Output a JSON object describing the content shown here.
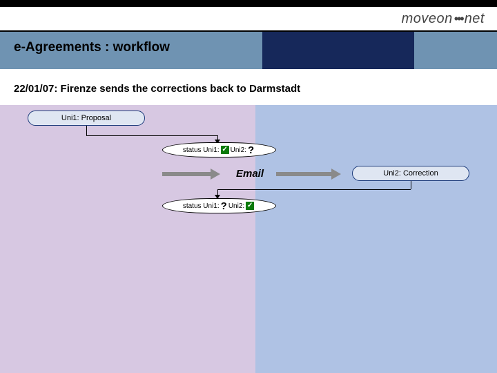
{
  "logo": {
    "part1": "moveon",
    "part2": "net"
  },
  "title": "e-Agreements : workflow",
  "subtitle": "22/01/07: Firenze sends the corrections back to Darmstadt",
  "nodes": {
    "uni1_proposal": "Uni1: Proposal",
    "uni2_correction": "Uni2: Correction"
  },
  "status1": {
    "label_uni1": "status Uni1:",
    "val_uni1": "check",
    "label_uni2": "Uni2:",
    "val_uni2": "?"
  },
  "status2": {
    "label_uni1": "status Uni1:",
    "val_uni1": "?",
    "label_uni2": "Uni2:",
    "val_uni2": "check"
  },
  "email_label": "Email",
  "colors": {
    "band": "#6f93b2",
    "band_dark": "#16285a",
    "shade_left": "#d7c8e2",
    "shade_right": "#afc2e4",
    "node_border": "#1b3a7a",
    "node_fill": "#dfe6f2"
  }
}
